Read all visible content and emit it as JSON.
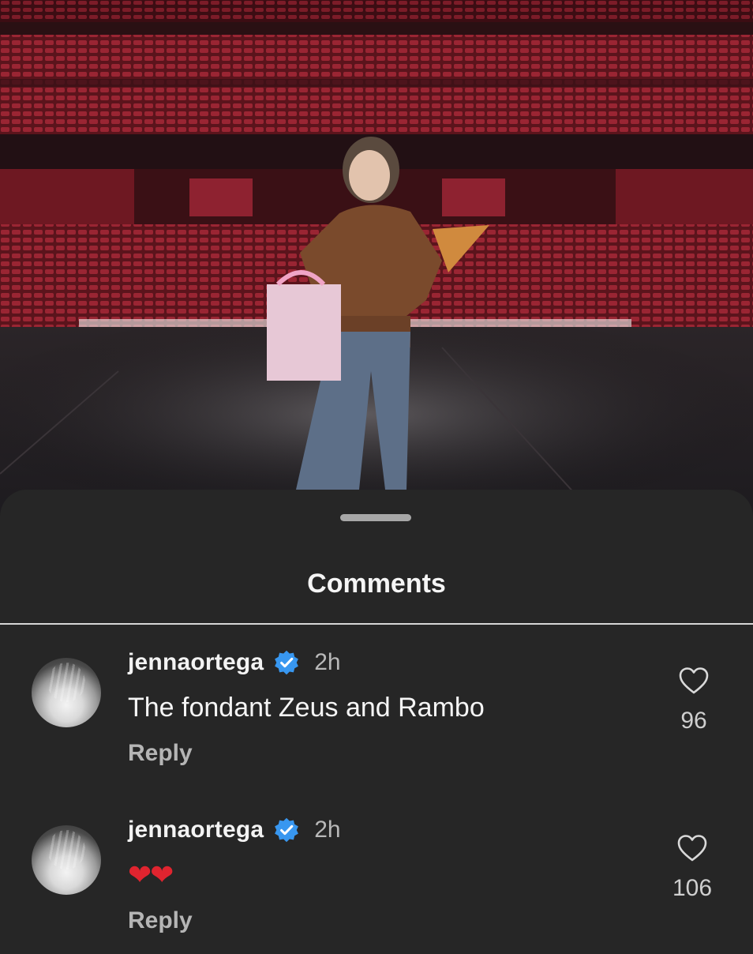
{
  "sheet": {
    "title": "Comments"
  },
  "comments": [
    {
      "username": "jennaortega",
      "time": "2h",
      "text": "The fondant Zeus and Rambo",
      "reply": "Reply",
      "likes": "96",
      "emoji": ""
    },
    {
      "username": "jennaortega",
      "time": "2h",
      "text": "",
      "reply": "Reply",
      "likes": "106",
      "emoji": "❤❤"
    }
  ],
  "colors": {
    "verified": "#3897f0",
    "sheet_bg": "#262626",
    "seat_red": "#8a1d28"
  }
}
